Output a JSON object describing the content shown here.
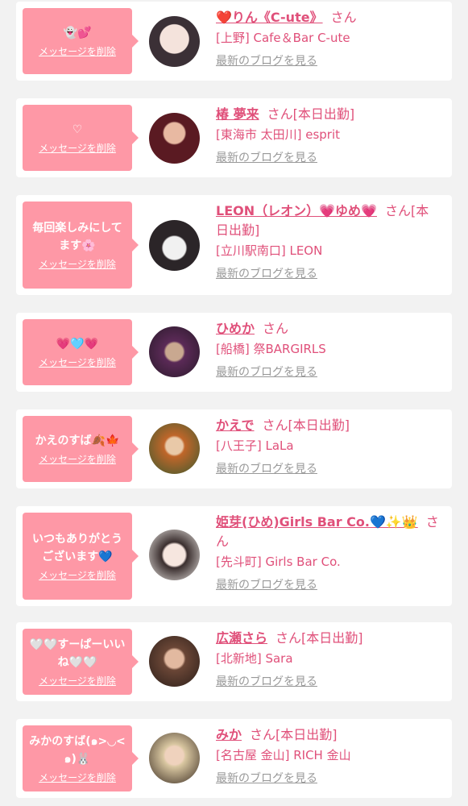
{
  "colors": {
    "accent": "#e0507a",
    "bubble": "#fe98a6",
    "background": "#f2f2f2",
    "link_gray": "#999999"
  },
  "common": {
    "delete_label": "メッセージを削除",
    "blog_label": "最新のブログを見る",
    "honorific": "さん"
  },
  "cards": [
    {
      "message": "👻💕",
      "name": "❤️りん《C-ute》",
      "status": "",
      "shop": "[上野] Cafe＆Bar C-ute"
    },
    {
      "message": "♡",
      "name": "椿 夢来",
      "status": "[本日出勤]",
      "shop": "[東海市 太田川] esprit"
    },
    {
      "message": "毎回楽しみにしてます🌸",
      "name": "LEON（レオン）💗ゆめ💗",
      "status": "[本日出勤]",
      "shop": "[立川駅南口] LEON"
    },
    {
      "message": "💗🩵💗",
      "name": "ひめか",
      "status": "",
      "shop": "[船橋] 祭BARGIRLS"
    },
    {
      "message": "かえのすば🍂🍁",
      "name": "かえで",
      "status": "[本日出勤]",
      "shop": "[八王子] LaLa"
    },
    {
      "message": "いつもありがとうございます💙",
      "name": "姫芽(ひめ)Girls Bar Co.💙✨👑",
      "status": "",
      "shop": "[先斗町] Girls Bar Co."
    },
    {
      "message": "🤍🤍すーぱーいいね🤍🤍",
      "name": "広瀬さら",
      "status": "[本日出勤]",
      "shop": "[北新地] Sara"
    },
    {
      "message": "みかのすば(๑>◡<๑)🐰",
      "name": "みか",
      "status": "[本日出勤]",
      "shop": "[名古屋 金山] RICH 金山"
    }
  ]
}
